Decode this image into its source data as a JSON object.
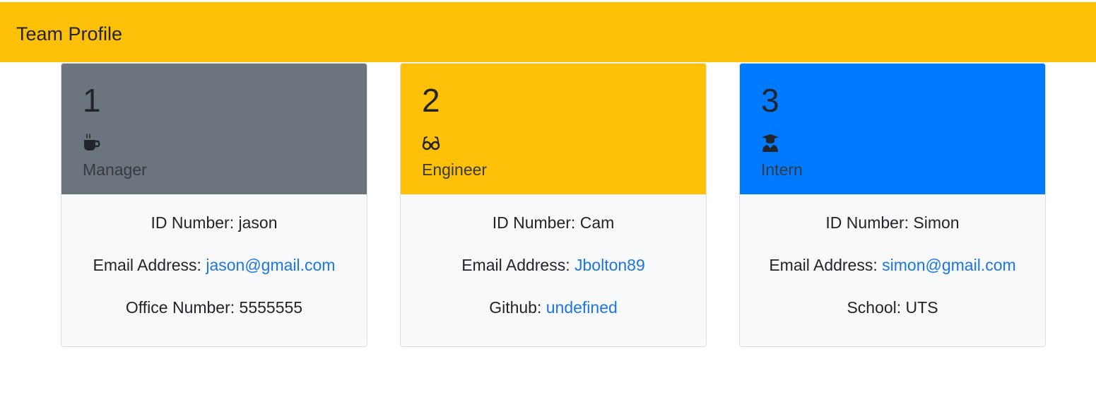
{
  "navbar": {
    "title": "Team Profile",
    "color": "#ffc107"
  },
  "cards": [
    {
      "number": "1",
      "icon": "coffee-mug-icon",
      "role": "Manager",
      "header_color": "#6c757d",
      "id_label": "ID Number: ",
      "id_value": "jason",
      "email_label": "Email Address: ",
      "email_value": "jason@gmail.com",
      "extra_label": "Office Number: ",
      "extra_value": "5555555"
    },
    {
      "number": "2",
      "icon": "glasses-icon",
      "role": "Engineer",
      "header_color": "#ffc107",
      "id_label": "ID Number: ",
      "id_value": "Cam",
      "email_label": "Email Address: ",
      "email_value": "Jbolton89",
      "extra_label": "Github: ",
      "extra_value": "undefined"
    },
    {
      "number": "3",
      "icon": "graduate-icon",
      "role": "Intern",
      "header_color": "#007bff",
      "id_label": "ID Number: ",
      "id_value": "Simon",
      "email_label": "Email Address: ",
      "email_value": "simon@gmail.com",
      "extra_label": "School: ",
      "extra_value": "UTS"
    }
  ],
  "colors": {
    "link": "#1b76e4",
    "card_body": "#f8f9fa"
  }
}
